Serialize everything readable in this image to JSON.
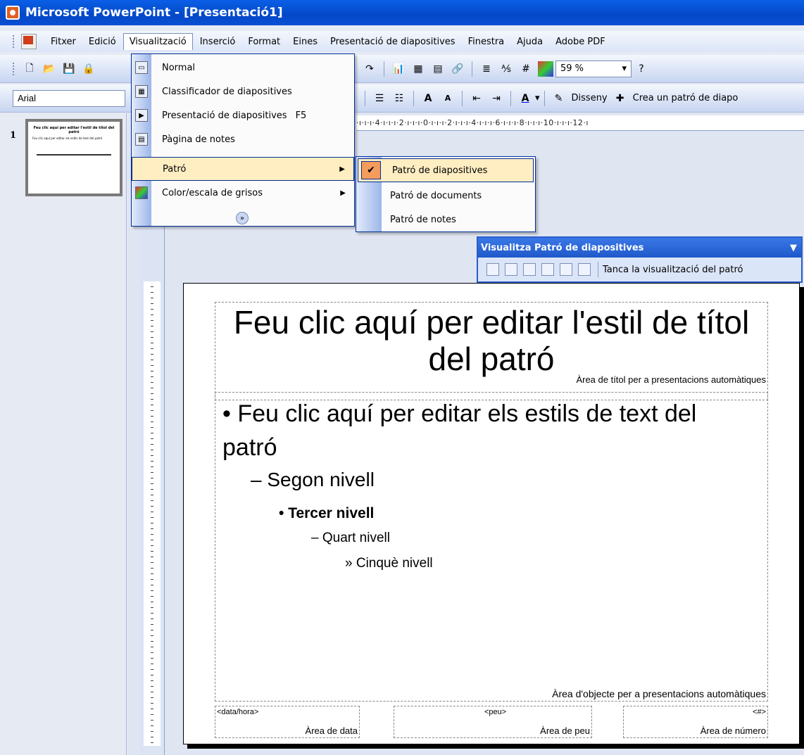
{
  "window": {
    "title": "Microsoft PowerPoint - [Presentació1]"
  },
  "menubar": {
    "items": [
      "Fitxer",
      "Edició",
      "Visualització",
      "Inserció",
      "Format",
      "Eines",
      "Presentació de diapositives",
      "Finestra",
      "Ajuda",
      "Adobe PDF"
    ]
  },
  "toolbar": {
    "zoom": "59 %",
    "font": "Arial",
    "design_label": "Disseny",
    "new_master_label": "Crea un patró de diapo"
  },
  "ruler": {
    "horizontal": "·ı·ı·ı·4·ı·ı·ı·2·ı·ı·ı·0·ı·ı·ı·2·ı·ı·ı·4·ı·ı·ı·6·ı·ı·ı·8·ı·ı·ı·10·ı·ı·ı·12·ı"
  },
  "slides_panel": {
    "slide_number": "1"
  },
  "view_menu": {
    "items": [
      {
        "label": "Normal",
        "shortcut": "",
        "submenu": false
      },
      {
        "label": "Classificador de diapositives",
        "shortcut": "",
        "submenu": false
      },
      {
        "label": "Presentació de diapositives",
        "shortcut": "F5",
        "submenu": false
      },
      {
        "label": "Pàgina de notes",
        "shortcut": "",
        "submenu": false
      },
      {
        "label": "Patró",
        "shortcut": "",
        "submenu": true
      },
      {
        "label": "Color/escala de grisos",
        "shortcut": "",
        "submenu": true
      }
    ]
  },
  "master_submenu": {
    "items": [
      "Patró de diapositives",
      "Patró de documents",
      "Patró de notes"
    ]
  },
  "master_toolbar": {
    "title": "Visualitza Patró de diapositives",
    "close_label": "Tanca la visualització del patró"
  },
  "slide": {
    "title": "Feu clic aquí per editar l'estil de títol del patró",
    "title_area_caption": "Àrea de títol per a presentacions automàtiques",
    "level1": "Feu clic aquí per editar els estils de text del patró",
    "level2": "Segon nivell",
    "level3": "Tercer nivell",
    "level4": "Quart nivell",
    "level5": "Cinquè nivell",
    "object_area_caption": "Àrea d'objecte per a presentacions automàtiques",
    "footer": {
      "date_placeholder": "<data/hora>",
      "date_caption": "Àrea de data",
      "footer_placeholder": "<peu>",
      "footer_caption": "Àrea de peu",
      "number_placeholder": "<#>",
      "number_caption": "Àrea de número"
    }
  },
  "thumbnail": {
    "title": "Feu clic aquí per editar l'estil de títol del patró",
    "body": "Feu clic aquí per editar els estils de text del patró"
  }
}
